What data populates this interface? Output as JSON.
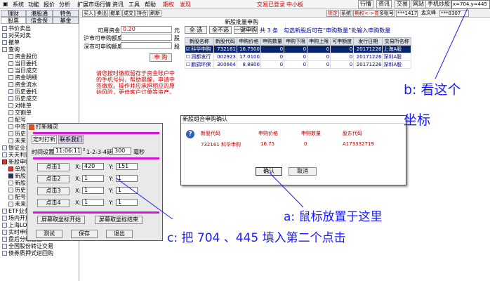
{
  "menubar": {
    "items": [
      "系统",
      "功能",
      "报价",
      "分析",
      "扩展市场行情",
      "资讯",
      "工具",
      "帮助"
    ],
    "red_items": [
      "期权",
      "发现"
    ],
    "center": [
      "交易已登录",
      "中小板"
    ],
    "right_buttons": [
      "行情",
      "资讯",
      "交易",
      "网站",
      "手机炒股"
    ],
    "coordinate": "x=704,y=445"
  },
  "left_tabs": [
    "理财",
    "港股通",
    "特色",
    "股票",
    "信金保",
    "基金"
  ],
  "tree": [
    {
      "label": "书价卖出",
      "level": 0,
      "icon": "doc"
    },
    {
      "label": "对买对卖",
      "level": 0,
      "icon": "doc"
    },
    {
      "label": "撤单",
      "level": 0,
      "icon": "doc"
    },
    {
      "label": "查询",
      "level": 0,
      "icon": "folder"
    },
    {
      "label": "资金股份",
      "level": 1,
      "icon": "doc"
    },
    {
      "label": "当日委托",
      "level": 1,
      "icon": "doc"
    },
    {
      "label": "当日成交",
      "level": 1,
      "icon": "doc"
    },
    {
      "label": "资金明细",
      "level": 1,
      "icon": "doc"
    },
    {
      "label": "资金流水",
      "level": 1,
      "icon": "doc"
    },
    {
      "label": "历史委托",
      "level": 1,
      "icon": "doc"
    },
    {
      "label": "历史成交",
      "level": 1,
      "icon": "doc"
    },
    {
      "label": "对帐单",
      "level": 1,
      "icon": "doc"
    },
    {
      "label": "交割单",
      "level": 1,
      "icon": "doc"
    },
    {
      "label": "配号",
      "level": 1,
      "icon": "doc"
    },
    {
      "label": "中签",
      "level": 1,
      "icon": "doc"
    },
    {
      "label": "历史",
      "level": 1,
      "icon": "doc"
    },
    {
      "label": "未来",
      "level": 1,
      "icon": "doc"
    },
    {
      "label": "银证业务",
      "level": 0,
      "icon": "doc"
    },
    {
      "label": "天天利财",
      "level": 0,
      "icon": "doc"
    },
    {
      "label": "新股申购",
      "level": 0,
      "icon": "red"
    },
    {
      "label": "单股",
      "level": 1,
      "icon": "red"
    },
    {
      "label": "新股",
      "level": 1,
      "icon": "dark"
    },
    {
      "label": "新股",
      "level": 1,
      "icon": "doc"
    },
    {
      "label": "历史",
      "level": 1,
      "icon": "doc"
    },
    {
      "label": "配号",
      "level": 1,
      "icon": "doc"
    },
    {
      "label": "未来",
      "level": 1,
      "icon": "doc"
    },
    {
      "label": "ETF业务",
      "level": 0,
      "icon": "doc"
    },
    {
      "label": "场内开放式基金",
      "level": 0,
      "icon": "doc"
    },
    {
      "label": "上海LOF",
      "level": 0,
      "icon": "doc"
    },
    {
      "label": "实时申赎货币基金",
      "level": 0,
      "icon": "doc"
    },
    {
      "label": "盘后分级基金",
      "level": 0,
      "icon": "doc"
    },
    {
      "label": "全国股份转让交易",
      "level": 0,
      "icon": "doc"
    },
    {
      "label": "债券质押式逆回购",
      "level": 0,
      "icon": "doc"
    }
  ],
  "toolbar": {
    "buttons": [
      "买入",
      "卖出",
      "撤单",
      "成交",
      "持仓",
      "刷新"
    ],
    "right_buttons": [
      "锁定",
      "系统",
      "期权<->普通",
      "多账号"
    ],
    "account": "***1417",
    "user": "孟文峰",
    "account2": "***8307"
  },
  "panel_title": "新股批量申购",
  "form": {
    "available_label": "可用资金",
    "available_value": "0.20",
    "available_unit": "元",
    "sh_label": "沪市可申购额度",
    "sh_unit": "股",
    "sz_label": "深市可申购额度",
    "sz_unit": "股",
    "apply_button": "申 购",
    "note": "请您按时缴款留存于资金账户中的手机号码，帮助提醒，申请中签缴款。操作并应承担相应的原始风险，更佳客户订单等资产。上市等程序。"
  },
  "grid_toolbar": {
    "select_all": "全 选",
    "select_none": "全不选",
    "one_key": "一键申购",
    "count": "共 3 条",
    "hint": "勾选新股后可在“申购数量”处输入申购数量"
  },
  "grid": {
    "headers": [
      "新股名称",
      "新股代码",
      "申购价格",
      "申购数量",
      "申购下限",
      "申购上限",
      "可申额度",
      "发行日期",
      "交易所名称"
    ],
    "rows": [
      [
        "科华申购",
        "732161",
        "16.7500",
        "0",
        "0",
        "0",
        "0",
        "20171226",
        "上海A股"
      ],
      [
        "润都发行",
        "002923",
        "17.0100",
        "0",
        "0",
        "0",
        "0",
        "20171226",
        "深圳A股"
      ],
      [
        "鹏鹞环保",
        "300664",
        "8.8800",
        "0",
        "0",
        "0",
        "0",
        "20171226",
        "深圳A股"
      ]
    ]
  },
  "confirm": {
    "title": "新股组合申购确认",
    "headers": [
      "新股代码",
      "申购价格",
      "申购数量",
      "股东代码"
    ],
    "row": [
      "732161 科华申购",
      "16.75",
      "0",
      "A173332719"
    ],
    "ok": "确认",
    "cancel": "取消"
  },
  "tool": {
    "title": "打新精灵",
    "tabs": [
      "定时打新",
      "联系我们"
    ],
    "time_label": "时间设置",
    "time_value": "11:06:11",
    "interval_label": "1-2-3-4延时",
    "interval_value": "300",
    "interval_unit": "毫秒",
    "points": [
      {
        "label": "点击1",
        "x": "420",
        "y": "151"
      },
      {
        "label": "点击2",
        "x": "1",
        "y": "1"
      },
      {
        "label": "点击3",
        "x": "1",
        "y": "1"
      },
      {
        "label": "点击4",
        "x": "1",
        "y": "1"
      }
    ],
    "x_label": "X:",
    "y_label": "Y:",
    "start_button": "屏幕取坐标开始",
    "end_button": "屏幕取坐标结束",
    "test_button": "测试",
    "save_button": "保存",
    "exit_button": "退出"
  },
  "annotations": {
    "b_line1": "b: 看这个",
    "b_line2": "坐标",
    "a": "a: 鼠标放置于这里",
    "c": "c: 把 704 、445 填入第二个点击"
  },
  "colors": {
    "annotation": "#1a1aff",
    "highlight_pink": "#d818d8",
    "selected_row": "#0a246a",
    "warning_red": "#d00000"
  }
}
